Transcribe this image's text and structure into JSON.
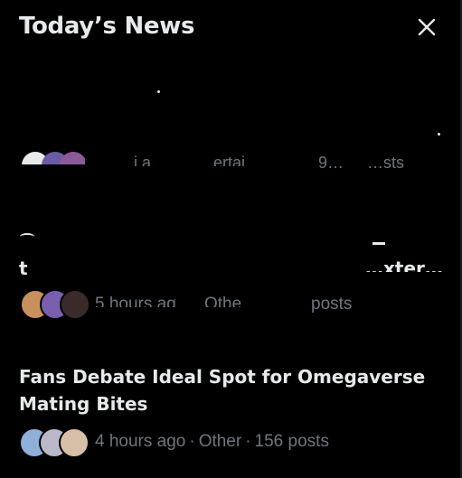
{
  "header": {
    "title": "Today’s News"
  },
  "icons": {
    "close": "close-icon"
  },
  "stories": [
    {
      "headline": "",
      "meta": {
        "time": "",
        "category": "",
        "posts": ""
      },
      "fragments": {
        "category_frag": "…ertai…",
        "count_frag": "9…",
        "posts_frag": "…sts",
        "a_frag": "…i a"
      }
    },
    {
      "headline": "t",
      "headline_end": "…xter…",
      "meta": {
        "time_frag": "5 hours ag",
        "category_frag": "Othe",
        "posts_frag": "posts"
      }
    },
    {
      "headline": "Fans Debate Ideal Spot for Omegaverse Mating Bites",
      "headline_line1": "Fans Debate Ideal Spot for Omegaverse",
      "headline_line2": "Mating Bites",
      "meta": {
        "time": "4 hours ago",
        "separator": "·",
        "category": "Other",
        "posts": "156 posts"
      }
    }
  ],
  "colors": {
    "background": "#000000",
    "primary_text": "#e7e9ea",
    "secondary_text": "#71767b"
  }
}
